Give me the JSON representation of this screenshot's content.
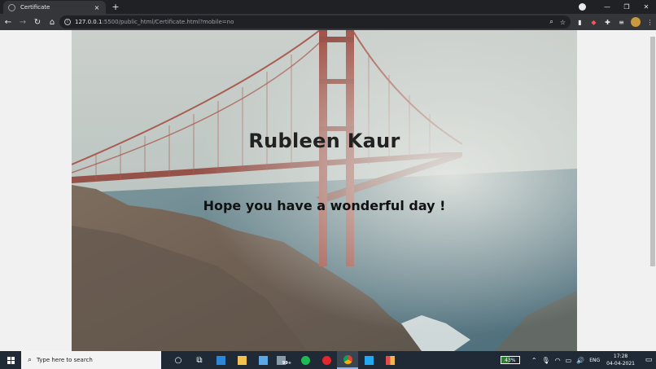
{
  "browser": {
    "tab_title": "Certificate",
    "tab_close": "×",
    "new_tab": "+",
    "url_host": "127.0.0.1",
    "url_rest": ":5500/public_html/Certificate.html?mobile=no",
    "window_minimize": "—",
    "window_restore": "❐",
    "window_close": "✕"
  },
  "certificate": {
    "name": "Rubleen Kaur",
    "message": "Hope you have a wonderful day !"
  },
  "taskbar": {
    "search_placeholder": "Type here to search",
    "battery": "43%",
    "language": "ENG",
    "time": "17:28",
    "date": "04-04-2021",
    "badge": "99+"
  },
  "colors": {
    "chrome_dark": "#202124",
    "chrome_toolbar": "#35363a",
    "taskbar": "#1f2a36",
    "sea": "#3f6a78",
    "bridge": "#9b3e33",
    "fog": "#dcdfdc"
  }
}
